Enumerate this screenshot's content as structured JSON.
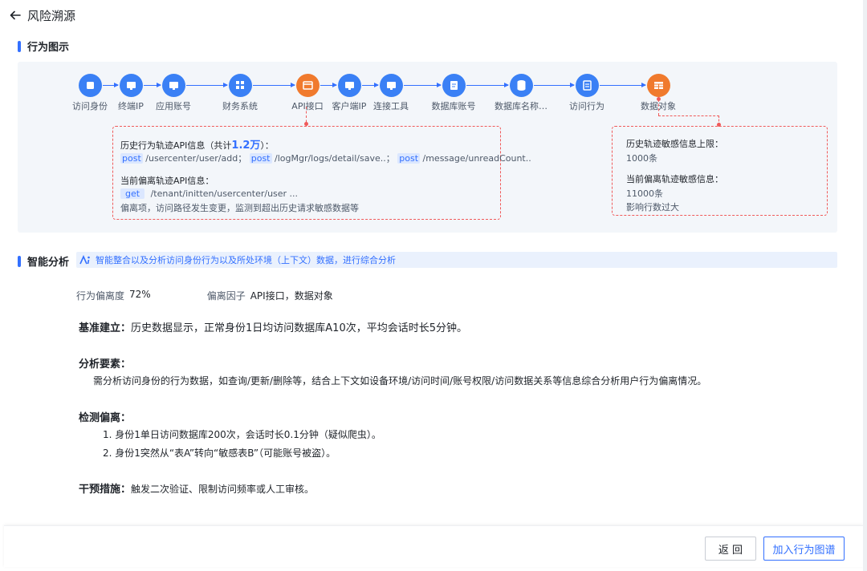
{
  "header": {
    "title": "风险溯源"
  },
  "behavior_section": {
    "title": "行为图示"
  },
  "flow_nodes": [
    {
      "label": "访问身份",
      "icon": "id-card-icon",
      "color": "#3a80f5"
    },
    {
      "label": "终端IP",
      "icon": "monitor-icon",
      "color": "#3a80f5"
    },
    {
      "label": "应用账号",
      "icon": "monitor-icon",
      "color": "#3a80f5"
    },
    {
      "label": "财务系统",
      "icon": "app-grid-icon",
      "color": "#3a80f5"
    },
    {
      "label": "API接口",
      "icon": "api-icon",
      "color": "#f07a2d"
    },
    {
      "label": "客户端IP",
      "icon": "monitor-icon",
      "color": "#3a80f5"
    },
    {
      "label": "连接工具",
      "icon": "monitor-icon",
      "color": "#3a80f5"
    },
    {
      "label": "数据库账号",
      "icon": "db-account-icon",
      "color": "#3a80f5"
    },
    {
      "label": "数据库名称…",
      "icon": "database-icon",
      "color": "#3a80f5"
    },
    {
      "label": "访问行为",
      "icon": "document-icon",
      "color": "#3a80f5"
    },
    {
      "label": "数据对象",
      "icon": "table-icon",
      "color": "#f07a2d"
    }
  ],
  "api_box": {
    "history_title": "历史行为轨迹API信息（共计",
    "history_count": "1.2万",
    "history_title_end": "）：",
    "history_items": [
      {
        "method": "post",
        "path": "/usercenter/user/add；"
      },
      {
        "method": "post",
        "path": "/logMgr/logs/detail/save..；"
      },
      {
        "method": "post",
        "path": "/message/unreadCount.."
      }
    ],
    "current_title": "当前偏离轨迹API信息：",
    "current_method": "get",
    "current_path": "/tenant/initten/usercenter/user ...",
    "deviation_note": "偏离项，访问路径发生变更，监测到超出历史请求敏感数据等"
  },
  "data_box": {
    "history_limit_title": "历史轨迹敏感信息上限：",
    "history_limit_value": "1000条",
    "current_title": "当前偏离轨迹敏感信息：",
    "current_value": "11000条",
    "impact_note": "影响行数过大"
  },
  "analysis_section": {
    "title": "智能分析",
    "banner": "智能整合以及分析访问身份行为以及所处环境（上下文）数据，进行综合分析"
  },
  "metrics": {
    "deviation_label": "行为偏离度",
    "deviation_value": "72%",
    "factor_label": "偏离因子",
    "factor_value": "API接口，数据对象"
  },
  "analysis": {
    "baseline_label": "基准建立：",
    "baseline_text": "历史数据显示，正常身份1日均访问数据库A10次，平均会话时长5分钟。",
    "elements_label": "分析要素：",
    "elements_text": "需分析访问身份的行为数据，如查询/更新/删除等，结合上下文如设备环境/访问时间/账号权限/访问数据关系等信息综合分析用户行为偏离情况。",
    "detect_label": "检测偏离：",
    "detect_items": [
      "1. 身份1单日访问数据库200次，会话时长0.1分钟（疑似爬虫）。",
      "2. 身份1突然从“表A”转向“敏感表B”（可能账号被盗）。"
    ],
    "measure_label": "干预措施：",
    "measure_text": "触发二次验证、限制访问频率或人工审核。"
  },
  "footer": {
    "back_label": "返 回",
    "add_label": "加入行为图谱"
  },
  "colors": {
    "accent": "#3370ff",
    "alert": "#f05a5a",
    "node_blue": "#3a80f5",
    "node_orange": "#f07a2d"
  }
}
